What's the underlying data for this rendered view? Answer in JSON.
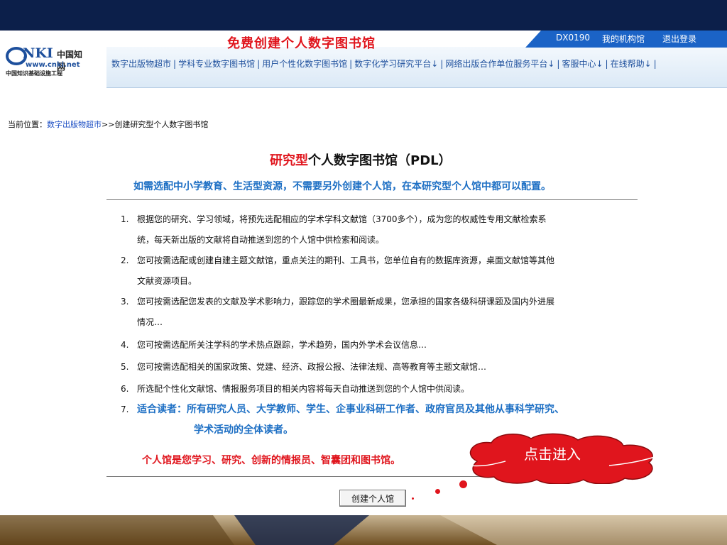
{
  "colors": {
    "navy": "#0c1f4a",
    "accent_red": "#e0151d",
    "accent_blue": "#1d6fc4",
    "link_blue": "#1d4fc4",
    "header_blue": "#1b63c6",
    "bottom_brown": "#7a5a2a"
  },
  "header": {
    "title": "免费创建个人数字图书馆",
    "top_links": [
      "DX0190",
      "我的机构馆",
      "退出登录"
    ],
    "logo": {
      "main": "NKI",
      "cn": "中国知网",
      "url": "www.cnki.net",
      "sub": "中国知识基础设施工程"
    }
  },
  "nav": [
    {
      "label": "数字出版物超市",
      "dropdown": false
    },
    {
      "label": "学科专业数字图书馆",
      "dropdown": false
    },
    {
      "label": "用户个性化数字图书馆",
      "dropdown": false
    },
    {
      "label": "数字化学习研究平台",
      "dropdown": true
    },
    {
      "label": "网络出版合作单位服务平台",
      "dropdown": true
    },
    {
      "label": "客服中心",
      "dropdown": true
    },
    {
      "label": "在线帮助",
      "dropdown": true
    }
  ],
  "nav_dropdown_arrow": "↓",
  "nav_separator": "|",
  "breadcrumb": {
    "prefix": "当前位置：",
    "link": "数字出版物超市",
    "current": ">>创建研究型个人数字图书馆"
  },
  "main": {
    "title_highlight": "研究型",
    "title_rest": "个人数字图书馆（PDL）",
    "subtitle": "如需选配中小学教育、生活型资源，不需要另外创建个人馆，在本研究型个人馆中都可以配置。",
    "items": [
      {
        "num": "1.",
        "lines": [
          "根据您的研究、学习领域，将预先选配相应的学术学科文献馆（3700多个），成为您的权威性专用文献检索系",
          "统，每天新出版的文献将自动推送到您的个人馆中供检索和阅读。"
        ]
      },
      {
        "num": "2.",
        "lines": [
          "您可按需选配或创建自建主题文献馆，重点关注的期刊、工具书，您单位自有的数据库资源，桌面文献馆等其他",
          "文献资源项目。"
        ]
      },
      {
        "num": "3.",
        "lines": [
          "您可按需选配您发表的文献及学术影响力，跟踪您的学术圈最新成果，您承担的国家各级科研课题及国内外进展",
          "情况…"
        ]
      },
      {
        "num": "4.",
        "lines": [
          "您可按需选配所关注学科的学术热点跟踪，学术趋势，国内外学术会议信息…"
        ]
      },
      {
        "num": "5.",
        "lines": [
          "您可按需选配相关的国家政策、党建、经济、政报公报、法律法规、高等教育等主题文献馆…"
        ]
      },
      {
        "num": "6.",
        "lines": [
          "所选配个性化文献馆、情报服务项目的相关内容将每天自动推送到您的个人馆中供阅读。"
        ]
      },
      {
        "num": "7.",
        "lines": [
          "适合读者：所有研究人员、大学教师、学生、企事业科研工作者、政府官员及其他从事科学研究、",
          "学术活动的全体读者。"
        ]
      }
    ],
    "footer_note": "个人馆是您学习、研究、创新的情报员、智囊团和图书馆。",
    "create_button": "创建个人馆"
  },
  "callout": {
    "label": "点击进入"
  }
}
